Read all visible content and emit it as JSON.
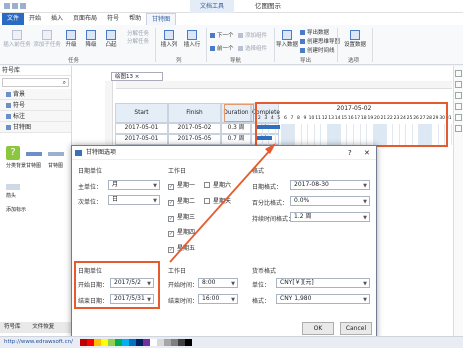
{
  "titlebar": {
    "context_tab": "文档工具",
    "title": "亿图图示"
  },
  "tabs": [
    "文件",
    "开始",
    "插入",
    "页面布局",
    "符号",
    "帮助",
    "甘特图"
  ],
  "ribbon": {
    "buttons": [
      "插入前任务",
      "添加子任务",
      "升级",
      "降级",
      "凸起",
      "分解任务",
      "分解任务",
      "插入列",
      "插入行"
    ],
    "small_items": [
      "下一个",
      "前一个",
      "添加组件",
      "选择组件",
      "导出数据",
      "创建思维导图",
      "创建时间线"
    ],
    "big": [
      "导入数据",
      "设置数据"
    ],
    "groups": [
      "任务",
      "列",
      "导航",
      "导出",
      "选项"
    ]
  },
  "left_panel": {
    "header": "符号库",
    "items": [
      "背景",
      "符号",
      "标注",
      "甘特图"
    ],
    "shape_labels": [
      "甘特图",
      "甘特图",
      "箭头",
      "添加标示",
      "分类背景"
    ],
    "bottom_tabs": [
      "符号库",
      "文件恢复"
    ]
  },
  "doc_tab": "绘图13",
  "gantt": {
    "headers": [
      "Start",
      "Finish",
      "Duration",
      "Complete"
    ],
    "rows": [
      {
        "start": "2017-05-01",
        "finish": "2017-05-02",
        "duration": "0.3 周",
        "complete": "0%"
      },
      {
        "start": "2017-05-01",
        "finish": "2017-05-05",
        "duration": "0.7 周",
        "complete": "0%"
      }
    ],
    "month": "2017-05-02",
    "days": [
      "2",
      "3",
      "4",
      "5",
      "6",
      "7",
      "8",
      "9",
      "10",
      "11",
      "12",
      "13",
      "14",
      "15",
      "16",
      "17",
      "18",
      "19",
      "20",
      "21",
      "22",
      "23",
      "24",
      "25",
      "26",
      "27",
      "28",
      "29",
      "30",
      "31"
    ]
  },
  "dialog": {
    "title": "甘特图选项",
    "date_unit": {
      "title": "日期单位",
      "major_label": "主单位：",
      "major": "月",
      "minor_label": "次单位：",
      "minor": "日"
    },
    "workdays": {
      "title": "工作日",
      "days": [
        {
          "label": "星期一",
          "checked": true
        },
        {
          "label": "星期二",
          "checked": true
        },
        {
          "label": "星期三",
          "checked": true
        },
        {
          "label": "星期四",
          "checked": true
        },
        {
          "label": "星期五",
          "checked": true
        },
        {
          "label": "星期六",
          "checked": false
        },
        {
          "label": "星期天",
          "checked": false
        }
      ]
    },
    "format": {
      "title": "格式",
      "date_label": "日期格式：",
      "date": "2017-08-30",
      "pct_label": "百分比格式：",
      "pct": "0.0%",
      "dur_label": "持续时间格式：",
      "dur": "1.2 周"
    },
    "date_range": {
      "title": "日期单位",
      "start_label": "开始日期：",
      "start": "2017/5/2",
      "end_label": "结束日期：",
      "end": "2017/5/31"
    },
    "worktime": {
      "title": "工作日",
      "start_label": "开始时间：",
      "start": "8:00",
      "end_label": "结束时间：",
      "end": "16:00"
    },
    "currency": {
      "title": "货币格式",
      "unit_label": "单位：",
      "unit": "CNY[￥][元]",
      "fmt_label": "格式：",
      "fmt": "CNY 1,980"
    },
    "ok": "OK",
    "cancel": "Cancel"
  },
  "status": {
    "url": "http://www.edrawsoft.cn/"
  },
  "colors": {
    "accent": "#2b6ac1",
    "highlight": "#e55b2e"
  }
}
